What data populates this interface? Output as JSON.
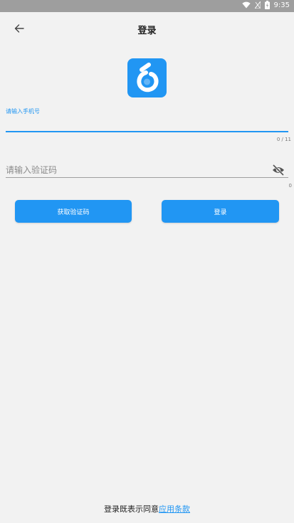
{
  "status_bar": {
    "time": "9:35",
    "icons": [
      "wifi-icon",
      "sim-icon",
      "battery-icon"
    ]
  },
  "app_bar": {
    "back_icon": "arrow-left-icon",
    "title": "登录"
  },
  "logo": {
    "icon": "app-logo-icon",
    "color": "#2196f3"
  },
  "phone_field": {
    "label": "请输入手机号",
    "value": "",
    "counter": "0 / 11"
  },
  "code_field": {
    "placeholder": "请输入验证码",
    "value": "",
    "counter": "0",
    "toggle_icon": "eye-off-icon"
  },
  "buttons": {
    "get_code_label": "获取验证码",
    "login_label": "登录"
  },
  "footer": {
    "terms_prefix": "登录既表示同意",
    "terms_link": "应用条款"
  },
  "colors": {
    "accent": "#2196f3",
    "background": "#f2f2f2",
    "status_bar": "#9e9e9e"
  }
}
